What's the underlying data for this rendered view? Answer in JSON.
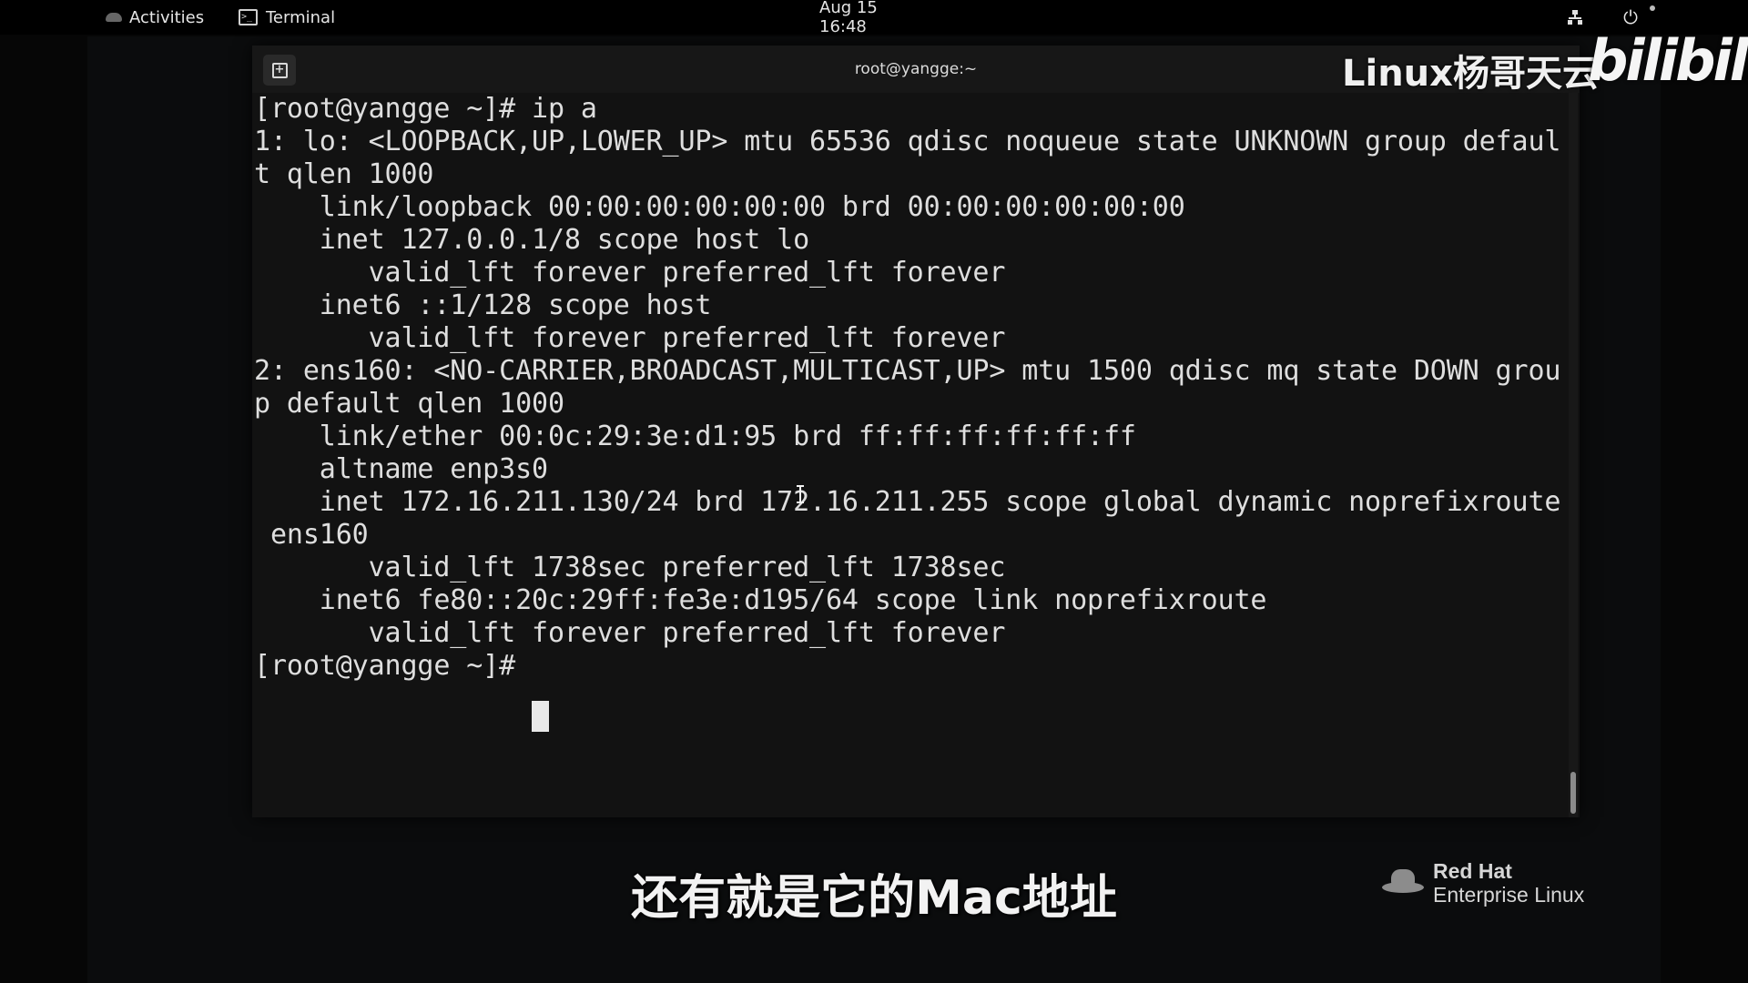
{
  "top_bar": {
    "activities_label": "Activities",
    "app_label": "Terminal",
    "clock": "Aug 15  16:48",
    "icons": [
      "network-icon",
      "power-icon"
    ]
  },
  "terminal": {
    "title": "root@yangge:~",
    "output": "[root@yangge ~]# ip a\n1: lo: <LOOPBACK,UP,LOWER_UP> mtu 65536 qdisc noqueue state UNKNOWN group defaul\nt qlen 1000\n    link/loopback 00:00:00:00:00:00 brd 00:00:00:00:00:00\n    inet 127.0.0.1/8 scope host lo\n       valid_lft forever preferred_lft forever\n    inet6 ::1/128 scope host\n       valid_lft forever preferred_lft forever\n2: ens160: <NO-CARRIER,BROADCAST,MULTICAST,UP> mtu 1500 qdisc mq state DOWN grou\np default qlen 1000\n    link/ether 00:0c:29:3e:d1:95 brd ff:ff:ff:ff:ff:ff\n    altname enp3s0\n    inet 172.16.211.130/24 brd 172.16.211.255 scope global dynamic noprefixroute\n ens160\n       valid_lft 1738sec preferred_lft 1738sec\n    inet6 fe80::20c:29ff:fe3e:d195/64 scope link noprefixroute\n       valid_lft forever preferred_lft forever\n[root@yangge ~]# ",
    "colors": {
      "background": "#121212",
      "foreground": "#dedede"
    }
  },
  "overlay": {
    "channel_watermark": "Linux杨哥天云",
    "bilibili_logo": "bilibili",
    "subtitle": "还有就是它的Mac地址",
    "redhat_line1": "Red Hat",
    "redhat_line2": "Enterprise Linux"
  }
}
